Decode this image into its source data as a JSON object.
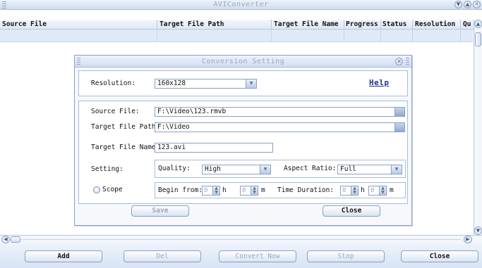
{
  "window": {
    "title": "AVIConverter",
    "controls": [
      "chevron-down-icon",
      "chevron-up-icon",
      "close-icon"
    ]
  },
  "table": {
    "columns": [
      "Source File",
      "Target File Path",
      "Target File Name",
      "Progress",
      "Status",
      "Resolution",
      "Qu"
    ],
    "rows": []
  },
  "dialog": {
    "title": "Conversion Setting",
    "resolution_label": "Resolution:",
    "resolution_value": "160x128",
    "help_label": "Help",
    "source_file_label": "Source File:",
    "source_file_value": "F:\\Video\\123.rmvb",
    "target_path_label": "Target File Path:",
    "target_path_value": "F:\\Video",
    "target_name_label": "Target File Name:",
    "target_name_value": "123.avi",
    "setting_label": "Setting:",
    "quality_label": "Quality:",
    "quality_value": "High",
    "aspect_label": "Aspect Ratio:",
    "aspect_value": "Full",
    "scope_label": "Scope",
    "begin_label": "Begin from:",
    "begin_h_value": "0",
    "h_unit": "h",
    "begin_m_value": "0",
    "m_unit": "m",
    "duration_label": "Time Duration:",
    "duration_h_value": "0",
    "duration_m_value": "0",
    "save_label": "Save",
    "close_label": "Close"
  },
  "toolbar": {
    "add_label": "Add",
    "del_label": "Del",
    "convert_label": "Convert Now",
    "stop_label": "Stop",
    "close_label": "Close"
  }
}
